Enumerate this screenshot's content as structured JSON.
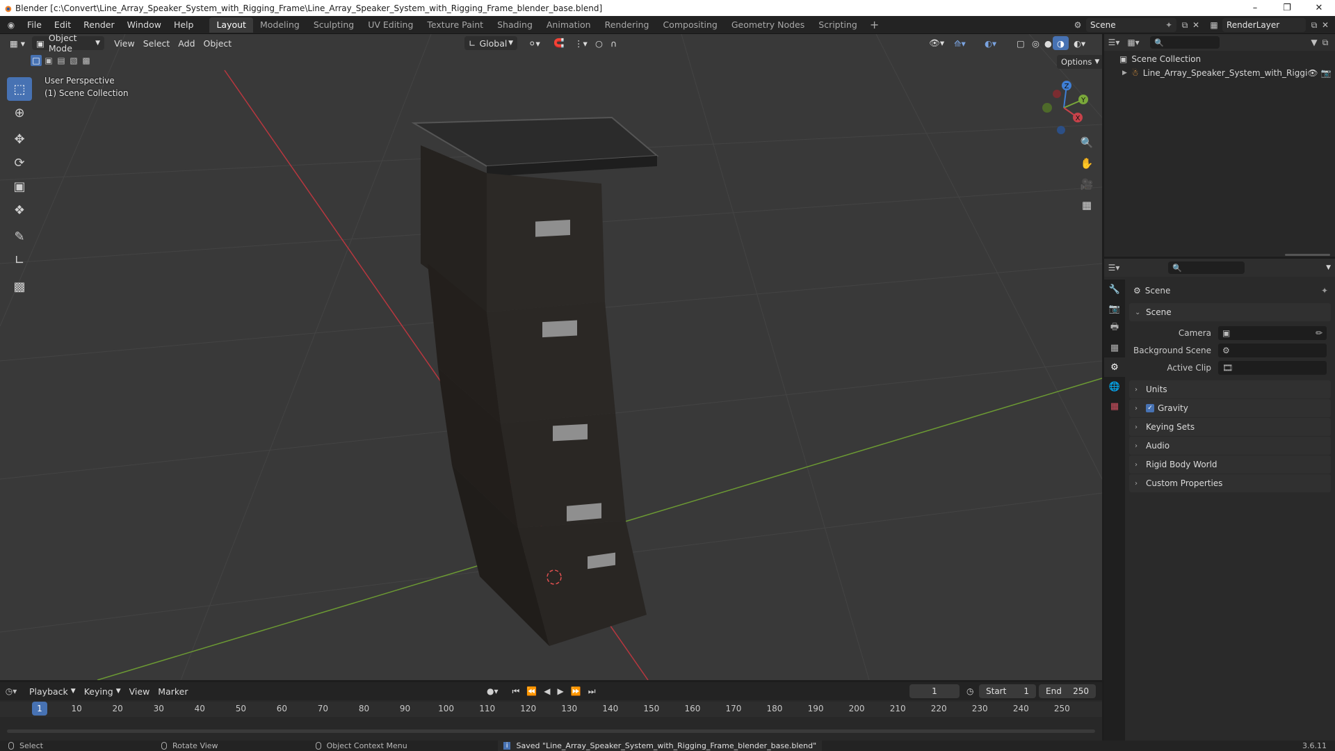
{
  "window": {
    "title": "Blender [c:\\Convert\\Line_Array_Speaker_System_with_Rigging_Frame\\Line_Array_Speaker_System_with_Rigging_Frame_blender_base.blend]"
  },
  "menu": [
    "File",
    "Edit",
    "Render",
    "Window",
    "Help"
  ],
  "workspaces": [
    {
      "label": "Layout",
      "active": true
    },
    {
      "label": "Modeling"
    },
    {
      "label": "Sculpting"
    },
    {
      "label": "UV Editing"
    },
    {
      "label": "Texture Paint"
    },
    {
      "label": "Shading"
    },
    {
      "label": "Animation"
    },
    {
      "label": "Rendering"
    },
    {
      "label": "Compositing"
    },
    {
      "label": "Geometry Nodes"
    },
    {
      "label": "Scripting"
    }
  ],
  "scene_selector": "Scene",
  "render_layer": "RenderLayer",
  "viewport": {
    "mode": "Object Mode",
    "menus": [
      "View",
      "Select",
      "Add",
      "Object"
    ],
    "transform_orientation": "Global",
    "options_label": "Options",
    "perspective": "User Perspective",
    "collection": "(1) Scene Collection",
    "gizmo_axes": {
      "x": "X",
      "y": "Y",
      "z": "Z"
    }
  },
  "outliner": {
    "root": "Scene Collection",
    "item": "Line_Array_Speaker_System_with_Riggi"
  },
  "properties": {
    "context_title": "Scene",
    "scene_panel": "Scene",
    "rows": [
      {
        "label": "Camera"
      },
      {
        "label": "Background Scene"
      },
      {
        "label": "Active Clip"
      }
    ],
    "panels": [
      "Units",
      "Gravity",
      "Keying Sets",
      "Audio",
      "Rigid Body World",
      "Custom Properties"
    ]
  },
  "timeline": {
    "menus": [
      "Playback",
      "Keying",
      "View",
      "Marker"
    ],
    "current_frame": "1",
    "start_label": "Start",
    "start": "1",
    "end_label": "End",
    "end": "250",
    "ticks": [
      "1",
      "10",
      "20",
      "30",
      "40",
      "50",
      "60",
      "70",
      "80",
      "90",
      "100",
      "110",
      "120",
      "130",
      "140",
      "150",
      "160",
      "170",
      "180",
      "190",
      "200",
      "210",
      "220",
      "230",
      "240",
      "250"
    ]
  },
  "status": {
    "select": "Select",
    "rotate": "Rotate View",
    "context_menu": "Object Context Menu",
    "message": "Saved \"Line_Array_Speaker_System_with_Rigging_Frame_blender_base.blend\"",
    "version": "3.6.11"
  },
  "colors": {
    "accent": "#4772b3",
    "x_axis": "#c8424a",
    "y_axis": "#7aa83a",
    "z_axis": "#3f7fd6"
  }
}
